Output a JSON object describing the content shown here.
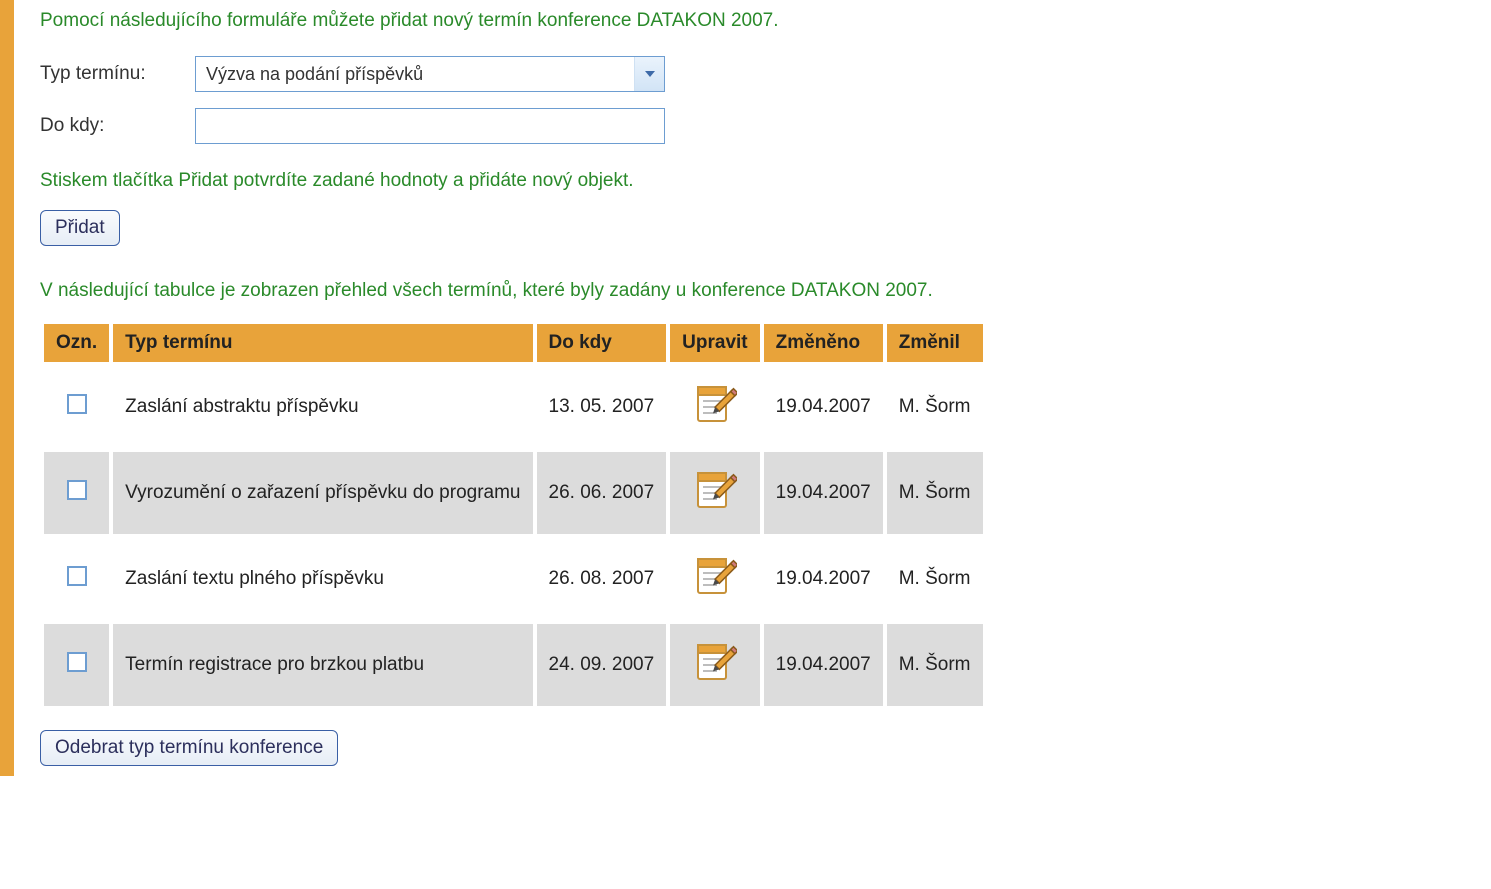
{
  "intro": "Pomocí následujícího formuláře můžete přidat nový termín konference DATAKON 2007.",
  "form": {
    "typeLabel": "Typ termínu:",
    "typeSelected": "Výzva na podání příspěvků",
    "doKdyLabel": "Do kdy:",
    "doKdyValue": ""
  },
  "hint": "Stiskem tlačítka Přidat potvrdíte zadané hodnoty a přidáte nový objekt.",
  "addButton": "Přidat",
  "tableCaption": "V následující tabulce je zobrazen přehled všech termínů, které byly zadány u konference DATAKON 2007.",
  "columns": {
    "ozn": "Ozn.",
    "typ": "Typ termínu",
    "doKdy": "Do kdy",
    "upravit": "Upravit",
    "zmeneno": "Změněno",
    "zmenil": "Změnil"
  },
  "rows": [
    {
      "typ": "Zaslání abstraktu příspěvku",
      "doKdy": "13. 05. 2007",
      "zmeneno": "19.04.2007",
      "zmenil": "M. Šorm"
    },
    {
      "typ": "Vyrozumění o zařazení příspěvku do programu",
      "doKdy": "26. 06. 2007",
      "zmeneno": "19.04.2007",
      "zmenil": "M. Šorm"
    },
    {
      "typ": "Zaslání textu plného příspěvku",
      "doKdy": "26. 08. 2007",
      "zmeneno": "19.04.2007",
      "zmenil": "M. Šorm"
    },
    {
      "typ": "Termín registrace pro brzkou platbu",
      "doKdy": "24. 09. 2007",
      "zmeneno": "19.04.2007",
      "zmenil": "M. Šorm"
    }
  ],
  "removeButton": "Odebrat typ termínu konference"
}
